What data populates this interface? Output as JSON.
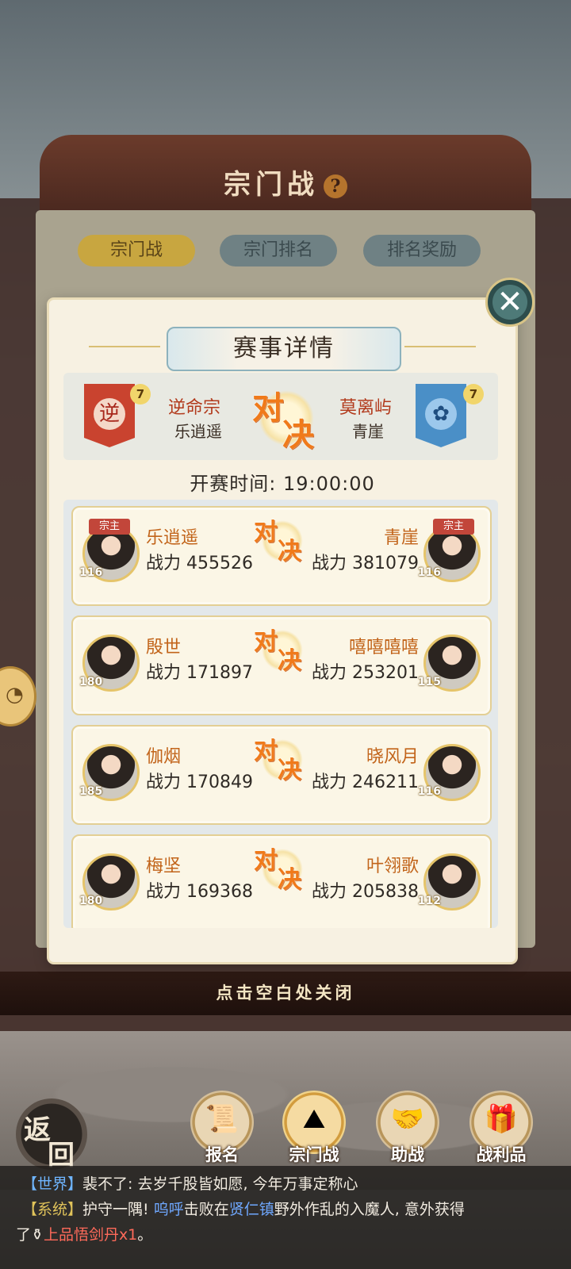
{
  "background": {
    "title": "宗门战",
    "help_icon": "?",
    "tabs": [
      {
        "label": "宗门战",
        "active": true
      },
      {
        "label": "宗门排名",
        "active": false
      },
      {
        "label": "排名奖励",
        "active": false
      }
    ],
    "close_hint": "点击空白处关闭"
  },
  "modal": {
    "title": "赛事详情",
    "team_left": {
      "name": "逆命宗",
      "leader": "乐逍遥",
      "emblem": "逆",
      "level": "7",
      "color": "#c9432f"
    },
    "team_right": {
      "name": "莫离屿",
      "leader": "青崖",
      "emblem": "✿",
      "level": "7",
      "color": "#4a8fc7"
    },
    "vs_text": [
      "对",
      "决"
    ],
    "start_time": "开赛时间: 19:00:00",
    "leader_tag": "宗主",
    "matches": [
      {
        "left": {
          "name": "乐逍遥",
          "power": "战力 455526",
          "level": "116",
          "leader": true
        },
        "right": {
          "name": "青崖",
          "power": "战力 381079",
          "level": "116",
          "leader": true
        }
      },
      {
        "left": {
          "name": "殷世",
          "power": "战力 171897",
          "level": "180",
          "leader": false
        },
        "right": {
          "name": "嘻嘻嘻嘻",
          "power": "战力 253201",
          "level": "115",
          "leader": false
        }
      },
      {
        "left": {
          "name": "伽烟",
          "power": "战力 170849",
          "level": "185",
          "leader": false
        },
        "right": {
          "name": "晓风月",
          "power": "战力 246211",
          "level": "116",
          "leader": false
        }
      },
      {
        "left": {
          "name": "梅坚",
          "power": "战力 169368",
          "level": "180",
          "leader": false
        },
        "right": {
          "name": "叶翎歌",
          "power": "战力 205838",
          "level": "112",
          "leader": false
        }
      }
    ]
  },
  "nav": {
    "back": [
      "返",
      "回"
    ],
    "items": [
      {
        "label": "报名",
        "icon": "scroll-icon",
        "glyph": "📜"
      },
      {
        "label": "宗门战",
        "icon": "flag-mountain-icon",
        "glyph": "⛰"
      },
      {
        "label": "助战",
        "icon": "handshake-icon",
        "glyph": "🤝"
      },
      {
        "label": "战利品",
        "icon": "chest-icon",
        "glyph": "🎁"
      }
    ]
  },
  "chat": {
    "line1": {
      "channel": "【世界】",
      "text": "裴不了: 去岁千股皆如愿, 今年万事定称心"
    },
    "line2": {
      "channel": "【系统】",
      "pre": "护守一隅! ",
      "name": "呜呼",
      "mid": "击败在",
      "place": "贤仁镇",
      "post": "野外作乱的入魔人, 意外获得"
    },
    "line3": {
      "pre": "了",
      "item": "上品悟剑丹x1",
      "post": "。"
    }
  }
}
